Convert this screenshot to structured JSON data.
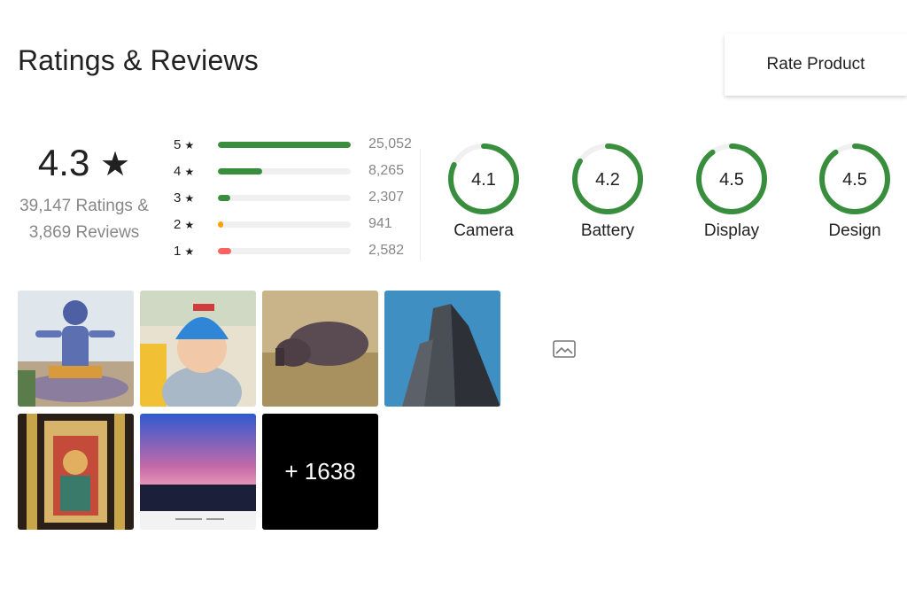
{
  "header": {
    "title": "Ratings & Reviews",
    "rate_button": "Rate Product"
  },
  "summary": {
    "average": "4.3",
    "star_glyph": "★",
    "ratings_text": "39,147 Ratings &",
    "reviews_text": "3,869 Reviews"
  },
  "distribution": [
    {
      "stars": "5",
      "count": "25,052",
      "fraction": 1.0,
      "color": "#388e3c"
    },
    {
      "stars": "4",
      "count": "8,265",
      "fraction": 0.33,
      "color": "#388e3c"
    },
    {
      "stars": "3",
      "count": "2,307",
      "fraction": 0.09,
      "color": "#388e3c"
    },
    {
      "stars": "2",
      "count": "941",
      "fraction": 0.04,
      "color": "#ff9f00"
    },
    {
      "stars": "1",
      "count": "2,582",
      "fraction": 0.1,
      "color": "#ff6161"
    }
  ],
  "aspects": [
    {
      "name": "Camera",
      "value": "4.1",
      "score": 4.1
    },
    {
      "name": "Battery",
      "value": "4.2",
      "score": 4.2
    },
    {
      "name": "Display",
      "value": "4.5",
      "score": 4.5
    },
    {
      "name": "Design",
      "value": "4.5",
      "score": 4.5
    }
  ],
  "gallery": {
    "more_label": "+ 1638",
    "icon": "image-icon"
  },
  "colors": {
    "accent_green": "#388e3c",
    "ring_track": "#f0f0f0"
  }
}
